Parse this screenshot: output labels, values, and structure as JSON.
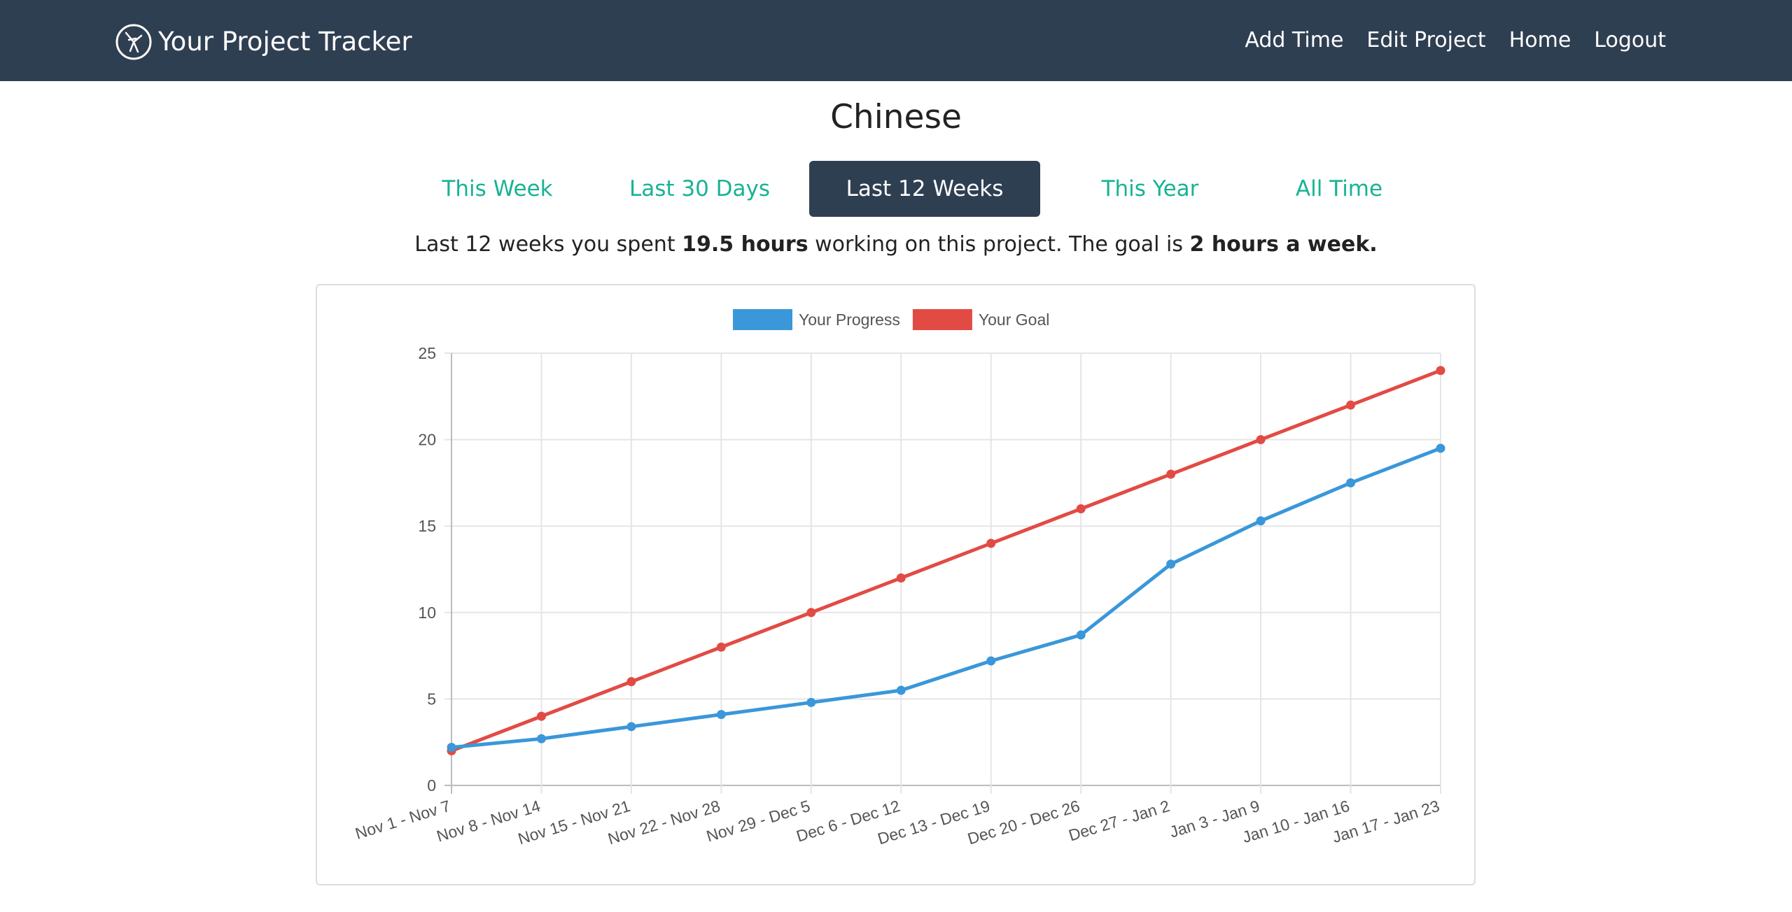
{
  "navbar": {
    "brand_title": "Your Project Tracker",
    "brand_icon": "logo-icon",
    "links": [
      {
        "label": "Add Time"
      },
      {
        "label": "Edit Project"
      },
      {
        "label": "Home"
      },
      {
        "label": "Logout"
      }
    ]
  },
  "project": {
    "title": "Chinese"
  },
  "tabs": [
    {
      "label": "This Week",
      "active": false
    },
    {
      "label": "Last 30 Days",
      "active": false
    },
    {
      "label": "Last 12 Weeks",
      "active": true
    },
    {
      "label": "This Year",
      "active": false
    },
    {
      "label": "All Time",
      "active": false
    }
  ],
  "summary": {
    "prefix": "Last 12 weeks you spent ",
    "hours": "19.5 hours",
    "middle": " working on this project. The goal is ",
    "goal": "2 hours a week."
  },
  "colors": {
    "navbar": "#2f3f52",
    "accent": "#18b394",
    "progress": "#3a97d9",
    "goal": "#e24b44"
  },
  "chart_data": {
    "type": "line",
    "categories": [
      "Nov  1 - Nov 7",
      "Nov  8 - Nov 14",
      "Nov 15 - Nov 21",
      "Nov 22 - Nov 28",
      "Nov 29 - Dec  5",
      "Dec  6 - Dec 12",
      "Dec 13 - Dec 19",
      "Dec 20 - Dec 26",
      "Dec 27 - Jan  2",
      "Jan  3 - Jan  9",
      "Jan 10 - Jan 16",
      "Jan 17 - Jan 23"
    ],
    "series": [
      {
        "name": "Your Progress",
        "color": "#3a97d9",
        "values": [
          2.2,
          2.7,
          3.4,
          4.1,
          4.8,
          5.5,
          7.2,
          8.7,
          12.8,
          15.3,
          17.5,
          19.5
        ]
      },
      {
        "name": "Your Goal",
        "color": "#e24b44",
        "values": [
          2,
          4,
          6,
          8,
          10,
          12,
          14,
          16,
          18,
          20,
          22,
          24
        ]
      }
    ],
    "ylim": [
      0,
      25
    ],
    "yticks": [
      0,
      5,
      10,
      15,
      20,
      25
    ],
    "grid": true,
    "legend_position": "top"
  }
}
